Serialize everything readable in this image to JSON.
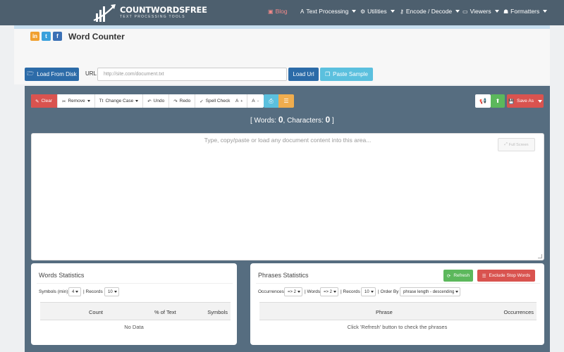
{
  "brand": {
    "name": "COUNTWORDSFREE",
    "tagline": "TEXT PROCESSING TOOLS"
  },
  "nav": [
    {
      "label": "Blog",
      "icon": "rss-icon"
    },
    {
      "label": "Text Processing",
      "icon": "font-icon"
    },
    {
      "label": "Utilities",
      "icon": "gear-icon"
    },
    {
      "label": "Encode / Decode",
      "icon": "key-icon"
    },
    {
      "label": "Viewers",
      "icon": "window-icon"
    },
    {
      "label": "Formatters",
      "icon": "user-icon"
    }
  ],
  "page": {
    "title": "Word Counter"
  },
  "social": [
    {
      "label": "in",
      "icon": "linkedin-icon",
      "color": "#f0a030"
    },
    {
      "label": "t",
      "icon": "twitter-icon",
      "color": "#3ba1dc"
    },
    {
      "label": "f",
      "icon": "facebook-icon",
      "color": "#3b70b5"
    }
  ],
  "loader": {
    "load_disk": "Load From Disk",
    "url_label": "URL",
    "url_placeholder": "http://site.com/document.txt",
    "load_url": "Load Url",
    "paste_sample": "Paste Sample"
  },
  "toolbar": {
    "clear": "Clear",
    "remove": "Remove",
    "change_case": "Change Case",
    "undo": "Undo",
    "redo": "Redo",
    "spell_check": "Spell Check",
    "font_up": "A",
    "font_down": "A",
    "save_as": "Save As"
  },
  "counts": {
    "prefix": "[ Words: ",
    "words": "0",
    "mid": ", Characters: ",
    "characters": "0",
    "suffix": " ]"
  },
  "editor": {
    "placeholder": "Type, copy/paste or load any document content into this area...",
    "fullscreen": "Full Screen"
  },
  "words_stats": {
    "title": "Words Statistics",
    "symbols_label": "Symbols (min)",
    "symbols_value": "4",
    "records_label": "Records",
    "records_value": "10",
    "columns": [
      "Count",
      "% of Text",
      "Symbols"
    ],
    "empty": "No Data"
  },
  "phrases_stats": {
    "title": "Phrases Statistics",
    "refresh": "Refresh",
    "exclude": "Exclude Stop Words",
    "occurrences_label": "Occurrences",
    "occurrences_value": "=> 2",
    "words_label": "Words",
    "words_value": "=> 2",
    "records_label": "Records",
    "records_value": "10",
    "order_label": "Order By",
    "order_value": "phrase length - descending",
    "columns": [
      "Phrase",
      "Occurrences"
    ],
    "empty": "Click 'Refresh' button to check the phrases"
  }
}
